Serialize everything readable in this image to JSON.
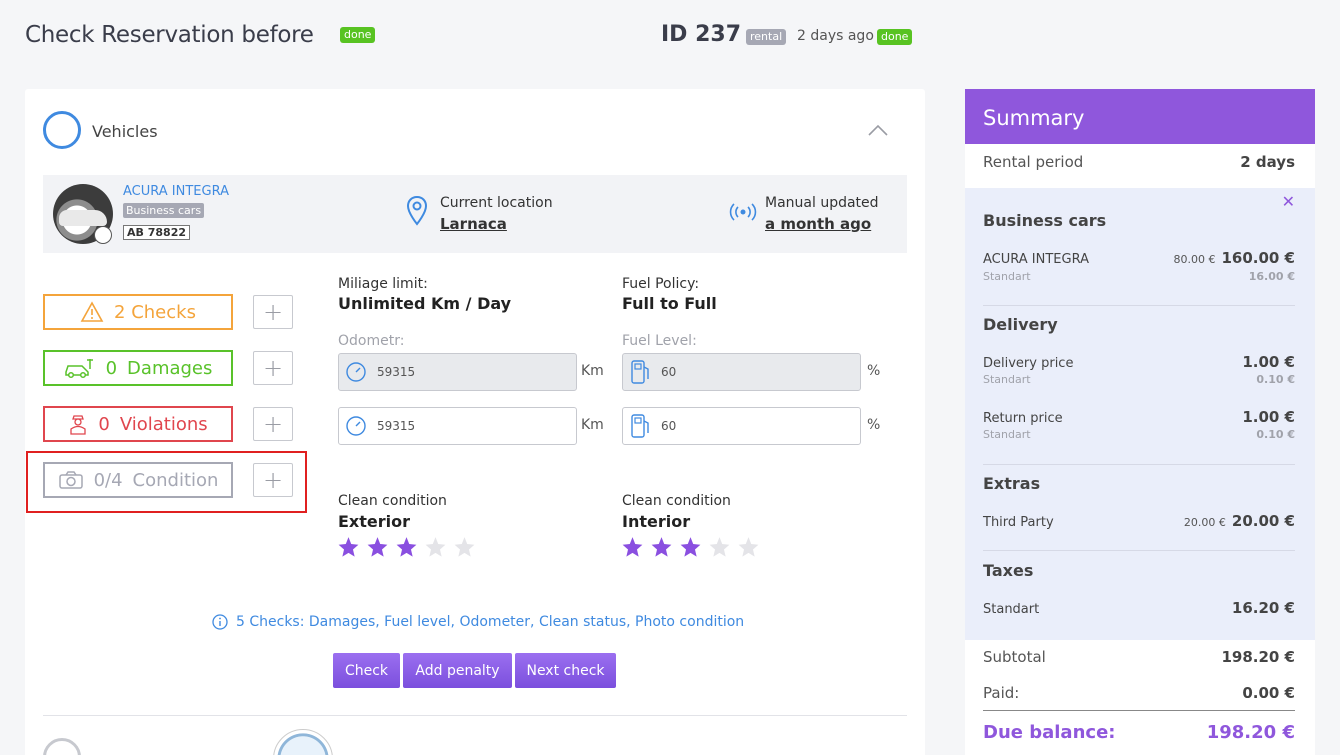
{
  "header": {
    "title": "Check Reservation before",
    "title_badge": "done",
    "id_label": "ID 237",
    "rental_badge": "rental",
    "time_ago": "2 days ago",
    "status_badge": "done"
  },
  "vehicles": {
    "section_title": "Vehicles",
    "car_name": "ACURA INTEGRA",
    "car_category": "Business cars",
    "plate": "AB 78822",
    "location_label": "Current location",
    "location_value": "Larnaca",
    "updated_label": "Manual updated",
    "updated_value": "a month ago"
  },
  "checks": {
    "checks_label": "2 Checks",
    "damages_count": "0",
    "damages_label": "Damages",
    "violations_count": "0",
    "violations_label": "Violations",
    "condition_count": "0/4",
    "condition_label": "Condition",
    "plus": "+"
  },
  "details": {
    "mileage_label": "Miliage limit:",
    "mileage_value": "Unlimited Km / Day",
    "fuel_policy_label": "Fuel Policy:",
    "fuel_policy_value": "Full to Full",
    "odometer_label": "Odometr:",
    "fuel_level_label": "Fuel Level:",
    "odometer_before": "59315",
    "odometer_now": "59315",
    "odometer_unit": "Km",
    "fuel_before": "60",
    "fuel_now": "60",
    "fuel_unit": "%",
    "clean_label": "Clean condition",
    "exterior_label": "Exterior",
    "interior_label": "Interior",
    "exterior_rating": 3,
    "interior_rating": 3,
    "rating_max": 5
  },
  "info_text": "5 Checks: Damages, Fuel level, Odometer, Clean status, Photo condition",
  "actions": {
    "check": "Check",
    "add_penalty": "Add penalty",
    "next_check": "Next check"
  },
  "summary": {
    "title": "Summary",
    "rental_period_label": "Rental period",
    "rental_period_value": "2 days",
    "close": "✕",
    "business_title": "Business cars",
    "car_item": "ACURA INTEGRA",
    "car_sub": "Standart",
    "car_price_small": "80.00 €",
    "car_price": "160.00 €",
    "car_tax": "16.00 €",
    "delivery_title": "Delivery",
    "delivery_item": "Delivery price",
    "delivery_sub": "Standart",
    "delivery_price": "1.00 €",
    "delivery_tax": "0.10 €",
    "return_item": "Return price",
    "return_sub": "Standart",
    "return_price": "1.00 €",
    "return_tax": "0.10 €",
    "extras_title": "Extras",
    "extras_item": "Third Party",
    "extras_price_small": "20.00 €",
    "extras_price": "20.00 €",
    "taxes_title": "Taxes",
    "taxes_item": "Standart",
    "taxes_price": "16.20 €",
    "subtotal_label": "Subtotal",
    "subtotal_value": "198.20 €",
    "paid_label": "Paid:",
    "paid_value": "0.00 €",
    "due_label": "Due balance:",
    "due_value": "198.20 €"
  },
  "colors": {
    "accent": "#8f57dc",
    "link": "#3f8ae0",
    "warning": "#f4a43b",
    "success": "#59c22a",
    "danger": "#e0464e",
    "muted": "#a6a8b4",
    "star_on": "#8a4fe0",
    "star_off": "#e4e4e8"
  }
}
